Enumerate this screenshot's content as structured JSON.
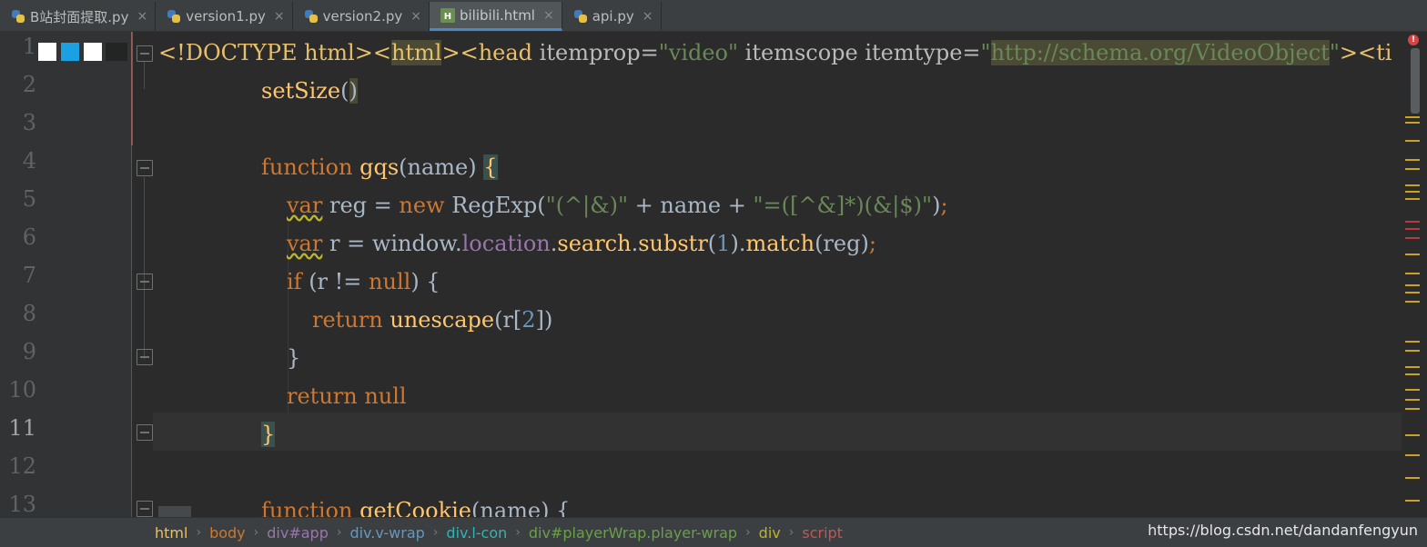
{
  "tabs": [
    {
      "label": "B站封面提取.py",
      "type": "py",
      "active": false
    },
    {
      "label": "version1.py",
      "type": "py",
      "active": false
    },
    {
      "label": "version2.py",
      "type": "py",
      "active": false
    },
    {
      "label": "bilibili.html",
      "type": "html",
      "active": true
    },
    {
      "label": "api.py",
      "type": "py",
      "active": false
    }
  ],
  "tab_close_glyph": "×",
  "line_numbers": [
    "1",
    "2",
    "3",
    "4",
    "5",
    "6",
    "7",
    "8",
    "9",
    "10",
    "11",
    "12",
    "13"
  ],
  "current_line": "11",
  "code": {
    "l1": {
      "t1": "<!DOCTYPE html>",
      "t2": "<",
      "t3": "html",
      "t4": ">",
      "t5": "<head ",
      "t6": "itemprop=",
      "t7": "\"video\"",
      "t8": " itemscope itemtype=",
      "t9": "\"",
      "t10": "http://schema.org/VideoObject",
      "t11": "\"",
      "t12": "><ti"
    },
    "l2": {
      "t1": "setSize",
      "t2": "(",
      "t3": ")"
    },
    "l4": {
      "t1": "function ",
      "t2": "gqs",
      "t3": "(name) ",
      "t4": "{"
    },
    "l5": {
      "t1": "var",
      "t2": " reg = ",
      "t3": "new ",
      "t4": "RegExp(",
      "t5": "\"(^|&)\"",
      "t6": " + name + ",
      "t7": "\"=([^&]*)(&|$)\"",
      "t8": ")",
      "t9": ";"
    },
    "l6": {
      "t1": "var",
      "t2": " r = window.",
      "t3": "location",
      "t4": ".",
      "t5": "search",
      "t6": ".",
      "t7": "substr",
      "t8": "(",
      "t9": "1",
      "t10": ").",
      "t11": "match",
      "t12": "(reg)",
      "t13": ";"
    },
    "l7": {
      "t1": "if ",
      "t2": "(r != ",
      "t3": "null",
      "t4": ") {"
    },
    "l8": {
      "t1": "return ",
      "t2": "unescape",
      "t3": "(r[",
      "t4": "2",
      "t5": "])"
    },
    "l9": {
      "t1": "}"
    },
    "l10": {
      "t1": "return null"
    },
    "l11": {
      "t1": "}"
    },
    "l13": {
      "t1": "function ",
      "t2": "getCookie",
      "t3": "(name) {"
    }
  },
  "breadcrumbs": [
    {
      "label": "html",
      "color": "#e8bf6a"
    },
    {
      "label": "body",
      "color": "#cc7832"
    },
    {
      "label": "div#app",
      "color": "#9876aa"
    },
    {
      "label": "div.v-wrap",
      "color": "#6897bb"
    },
    {
      "label": "div.l-con",
      "color": "#2eb5b5"
    },
    {
      "label": "div#playerWrap.player-wrap",
      "color": "#6a9f4a"
    },
    {
      "label": "div",
      "color": "#bbb529"
    },
    {
      "label": "script",
      "color": "#c75450"
    }
  ],
  "breadcrumb_separator": "›",
  "watermark": "https://blog.csdn.net/dandanfengyun",
  "error_indicator": "!",
  "colors": {
    "background": "#2b2b2b",
    "keyword": "#cc7832",
    "string": "#6a8759",
    "number": "#6897bb",
    "function": "#ffc66d",
    "accent": "#4a88c7"
  }
}
